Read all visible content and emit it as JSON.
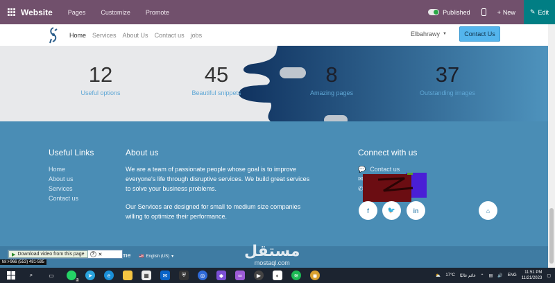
{
  "editor_bar": {
    "brand": "Website",
    "menu": [
      "Pages",
      "Customize",
      "Promote"
    ],
    "published_label": "Published",
    "new_label": "New",
    "edit_label": "Edit"
  },
  "site_header": {
    "nav": [
      "Home",
      "Services",
      "About Us",
      "Contact us",
      "jobs"
    ],
    "user_name": "Elbahrawy",
    "contact_button": "Contact Us"
  },
  "stats": [
    {
      "number": "12",
      "label": "Useful options"
    },
    {
      "number": "45",
      "label": "Beautiful snippets"
    },
    {
      "number": "8",
      "label": "Amazing pages"
    },
    {
      "number": "37",
      "label": "Outstanding images"
    }
  ],
  "footer": {
    "useful_links_title": "Useful Links",
    "useful_links": [
      "Home",
      "About us",
      "Services",
      "Contact us"
    ],
    "about_title": "About us",
    "about_p1": "We are a team of passionate people whose goal is to improve everyone's life through disruptive services. We build great services to solve your business problems.",
    "about_p2": "Our Services are designed for small to medium size companies willing to optimize their performance.",
    "connect_title": "Connect with us",
    "connect_contact": "Contact us"
  },
  "bottom": {
    "language": "English (US)",
    "me_text": "me",
    "download_label": "Download video from this page",
    "help": "?",
    "close": "✕",
    "phone": "tel:+966 (553) 481-595",
    "watermark_ar": "مستقل",
    "watermark_en": "mostaql.com"
  },
  "taskbar": {
    "weather": "17°C",
    "weather_text": "غائم غالبًا",
    "lang": "ENG",
    "time": "11:51 PM",
    "date": "11/21/2023",
    "badge": "2"
  },
  "colors": {
    "editor_bar": "#71506c",
    "edit_button": "#017e84",
    "accent": "#54b5ed",
    "footer": "#4a8db5",
    "stats_dark": "#1a3d66"
  }
}
